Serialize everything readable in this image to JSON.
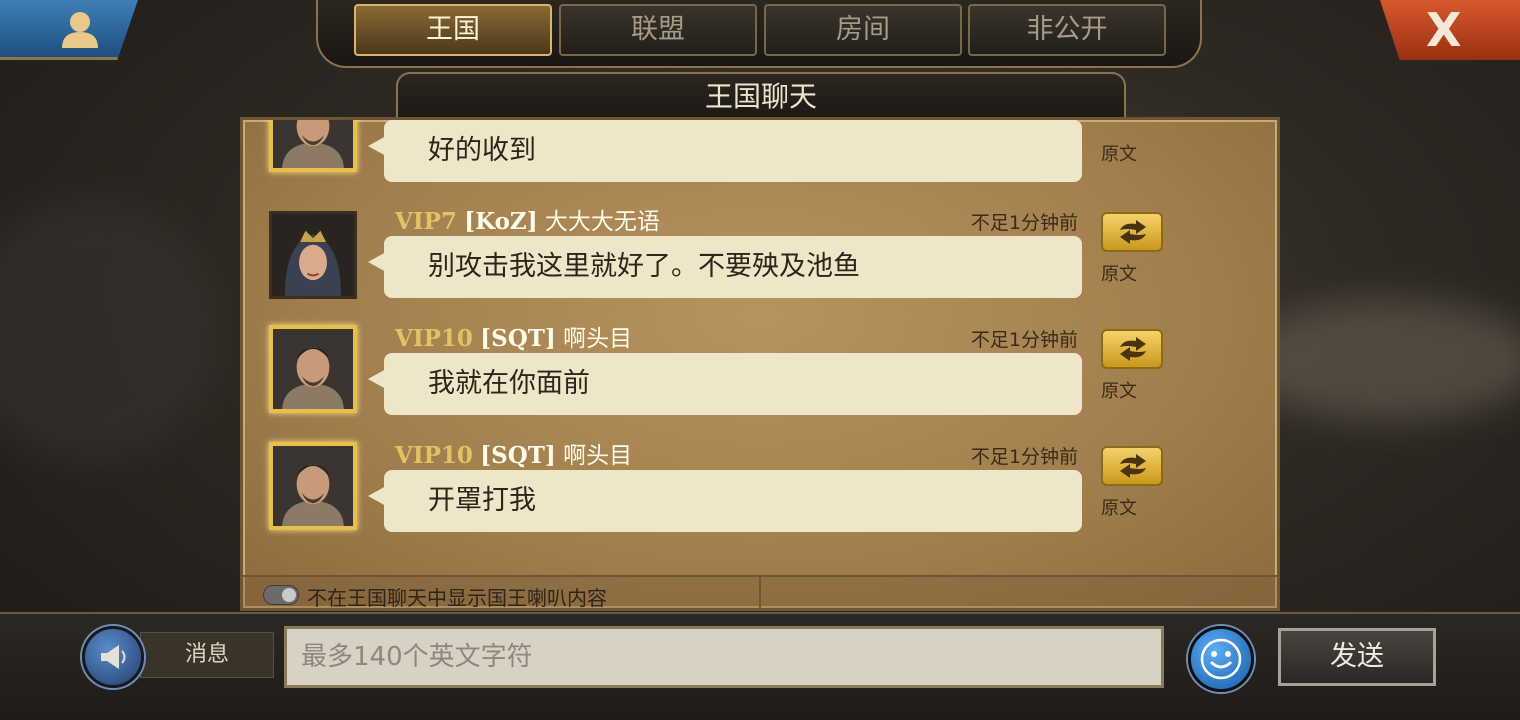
{
  "tabs": [
    {
      "label": "王国",
      "active": true
    },
    {
      "label": "联盟",
      "active": false
    },
    {
      "label": "房间",
      "active": false
    },
    {
      "label": "非公开",
      "active": false
    }
  ],
  "header": {
    "title": "王国聊天",
    "close_label": "X"
  },
  "messages": [
    {
      "vip": "",
      "tag": "",
      "name": "",
      "time": "",
      "text": "好的收到",
      "original_label": "原文",
      "avatar": "male-knight-gold"
    },
    {
      "vip": "VIP7",
      "tag": "[KoZ]",
      "name": "大大大无语",
      "time": "不足1分钟前",
      "text": "别攻击我这里就好了。不要殃及池鱼",
      "original_label": "原文",
      "avatar": "female-crowned"
    },
    {
      "vip": "VIP10",
      "tag": "[SQT]",
      "name": "啊头目",
      "time": "不足1分钟前",
      "text": "我就在你面前",
      "original_label": "原文",
      "avatar": "male-knight-gold"
    },
    {
      "vip": "VIP10",
      "tag": "[SQT]",
      "name": "啊头目",
      "time": "不足1分钟前",
      "text": "开罩打我",
      "original_label": "原文",
      "avatar": "male-knight-gold"
    }
  ],
  "footer": {
    "toggle_label": "不在王国聊天中显示国王喇叭内容",
    "toggle_on": false
  },
  "input": {
    "channel_label": "消息",
    "placeholder": "最多140个英文字符",
    "value": "",
    "send_label": "发送"
  },
  "colors": {
    "vip": "#e4c066",
    "active_tab": "#8a6a35",
    "close": "#d65a2c",
    "parchment": "#a17e4d",
    "bubble": "#eee6c9"
  }
}
